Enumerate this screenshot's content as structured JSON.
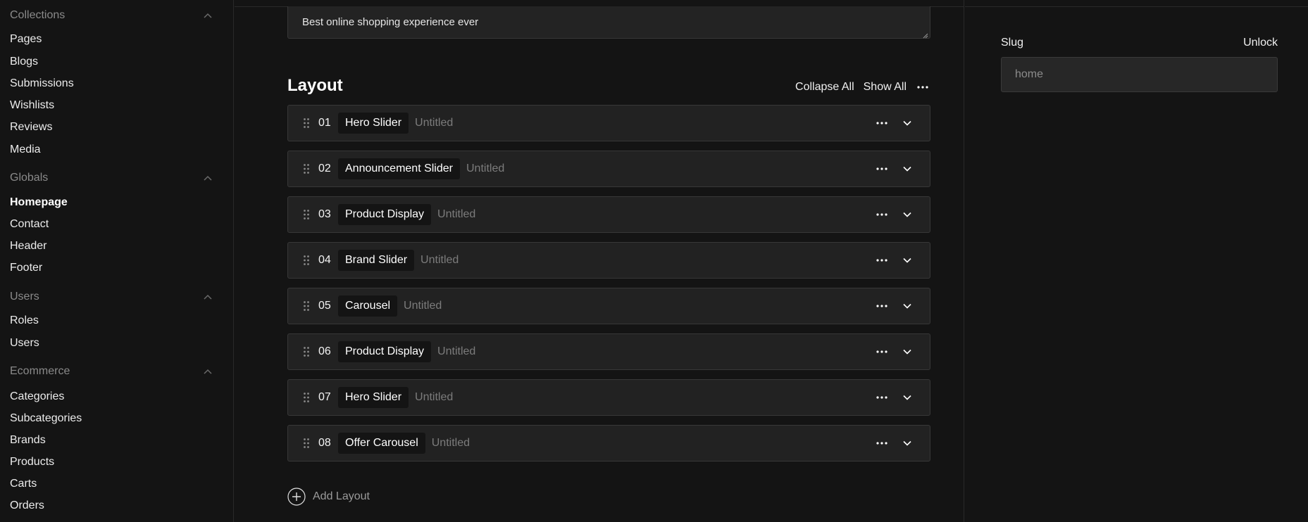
{
  "sidebar": {
    "groups": [
      {
        "label": "Collections",
        "items": [
          "Pages",
          "Blogs",
          "Submissions",
          "Wishlists",
          "Reviews",
          "Media"
        ]
      },
      {
        "label": "Globals",
        "items": [
          "Homepage",
          "Contact",
          "Header",
          "Footer"
        ]
      },
      {
        "label": "Users",
        "items": [
          "Roles",
          "Users"
        ]
      },
      {
        "label": "Ecommerce",
        "items": [
          "Categories",
          "Subcategories",
          "Brands",
          "Products",
          "Carts",
          "Orders"
        ]
      }
    ],
    "active_item": "Homepage"
  },
  "main": {
    "description_value": "Best online shopping experience ever",
    "layout": {
      "title": "Layout",
      "collapse_all_label": "Collapse All",
      "show_all_label": "Show All",
      "rows": [
        {
          "number": "01",
          "block_type": "Hero Slider",
          "title": "Untitled"
        },
        {
          "number": "02",
          "block_type": "Announcement Slider",
          "title": "Untitled"
        },
        {
          "number": "03",
          "block_type": "Product Display",
          "title": "Untitled"
        },
        {
          "number": "04",
          "block_type": "Brand Slider",
          "title": "Untitled"
        },
        {
          "number": "05",
          "block_type": "Carousel",
          "title": "Untitled"
        },
        {
          "number": "06",
          "block_type": "Product Display",
          "title": "Untitled"
        },
        {
          "number": "07",
          "block_type": "Hero Slider",
          "title": "Untitled"
        },
        {
          "number": "08",
          "block_type": "Offer Carousel",
          "title": "Untitled"
        }
      ],
      "add_label": "Add Layout"
    }
  },
  "side_panel": {
    "slug_label": "Slug",
    "unlock_label": "Unlock",
    "slug_value": "home"
  },
  "colors": {
    "background": "#141414",
    "row_background": "#222222",
    "border": "#383838",
    "muted_text": "#7c7c7c"
  }
}
